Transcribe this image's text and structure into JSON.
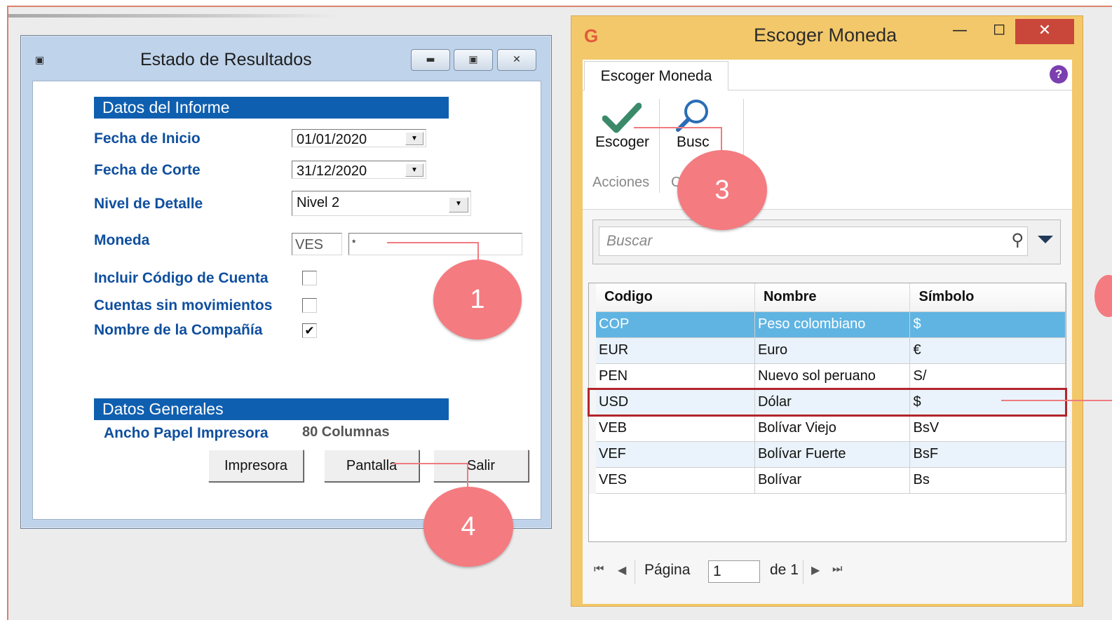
{
  "left_window": {
    "title": "Estado de Resultados",
    "section_informe": "Datos del Informe",
    "fields": {
      "fecha_inicio_label": "Fecha de Inicio",
      "fecha_inicio_value": "01/01/2020",
      "fecha_corte_label": "Fecha de Corte",
      "fecha_corte_value": "31/12/2020",
      "nivel_label": "Nivel de Detalle",
      "nivel_value": "Nivel 2",
      "moneda_label": "Moneda",
      "moneda_code": "VES",
      "moneda_value": "*",
      "incluir_codigo_label": "Incluir Código de Cuenta",
      "cuentas_sin_mov_label": "Cuentas sin movimientos",
      "nombre_compania_label": "Nombre de la Compañía"
    },
    "checkboxes": {
      "incluir_codigo": false,
      "cuentas_sin_mov": false,
      "nombre_compania": true
    },
    "section_generales": "Datos Generales",
    "ancho_label": "Ancho Papel Impresora",
    "ancho_value": "80 Columnas",
    "buttons": {
      "impresora": "Impresora",
      "pantalla": "Pantalla",
      "salir": "Salir"
    }
  },
  "right_window": {
    "title": "Escoger Moneda",
    "tab_label": "Escoger Moneda",
    "ribbon": {
      "escoger_label": "Escoger",
      "buscar_label": "Busc",
      "group_acciones": "Acciones",
      "group_other": "C"
    },
    "search_placeholder": "Buscar",
    "grid": {
      "headers": [
        "Codigo",
        "Nombre",
        "Símbolo"
      ],
      "rows": [
        [
          "COP",
          "Peso colombiano",
          "$"
        ],
        [
          "EUR",
          "Euro",
          "€"
        ],
        [
          "PEN",
          "Nuevo sol peruano",
          "S/"
        ],
        [
          "USD",
          "Dólar",
          "$"
        ],
        [
          "VEB",
          "Bolívar Viejo",
          "BsV"
        ],
        [
          "VEF",
          "Bolívar Fuerte",
          "BsF"
        ],
        [
          "VES",
          "Bolívar",
          "Bs"
        ]
      ],
      "selected_row": 0,
      "highlighted_row": 3
    },
    "pager": {
      "label": "Página",
      "page": "1",
      "total": "de 1"
    }
  },
  "callouts": [
    "1",
    "3",
    "4"
  ],
  "colors": {
    "section_bar": "#0f5fb0",
    "label_blue": "#0f4f9e",
    "window_accent": "#f3c86a",
    "selected_row": "#5fb4e2",
    "callout": "#f47b80",
    "highlight_border": "#b3242c"
  }
}
